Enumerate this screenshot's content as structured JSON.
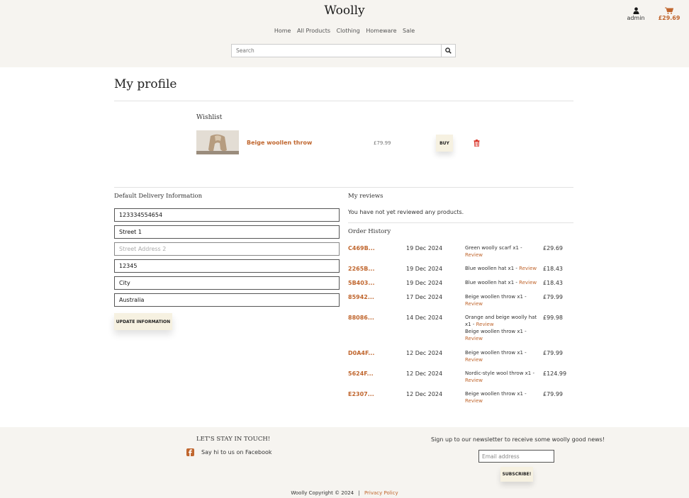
{
  "header": {
    "brand": "Woolly",
    "nav": [
      "Home",
      "All Products",
      "Clothing",
      "Homeware",
      "Sale"
    ],
    "search_placeholder": "Search",
    "account_label": "admin",
    "cart_total": "£29.69"
  },
  "profile": {
    "title": "My profile",
    "wishlist": {
      "heading": "Wishlist",
      "item": {
        "name": "Beige woollen throw",
        "price": "£79.99",
        "buy_label": "BUY"
      }
    },
    "delivery": {
      "heading": "Default Delivery Information",
      "fields": [
        {
          "value": "123334554654",
          "placeholder": ""
        },
        {
          "value": "Street 1",
          "placeholder": ""
        },
        {
          "value": "",
          "placeholder": "Street Address 2"
        },
        {
          "value": "12345",
          "placeholder": ""
        },
        {
          "value": "City",
          "placeholder": ""
        },
        {
          "value": "Australia",
          "placeholder": ""
        }
      ],
      "update_label": "UPDATE INFORMATION"
    },
    "reviews": {
      "heading": "My reviews",
      "empty_text": "You have not yet reviewed any products."
    },
    "order_history": {
      "heading": "Order History",
      "review_label": "Review",
      "orders": [
        {
          "number": "C469B...",
          "date": "19 Dec 2024",
          "items": [
            "Green woolly scarf x1 -"
          ],
          "total": "£29.69"
        },
        {
          "number": "2265B...",
          "date": "19 Dec 2024",
          "items": [
            "Blue woollen hat x1 -"
          ],
          "total": "£18.43"
        },
        {
          "number": "5B403...",
          "date": "19 Dec 2024",
          "items": [
            "Blue woollen hat x1 -"
          ],
          "total": "£18.43"
        },
        {
          "number": "85942...",
          "date": "17 Dec 2024",
          "items": [
            "Beige woollen throw x1 -"
          ],
          "total": "£79.99"
        },
        {
          "number": "88086...",
          "date": "14 Dec 2024",
          "items": [
            "Orange and beige woolly hat x1 -",
            "Beige woollen throw x1 -"
          ],
          "total": "£99.98"
        },
        {
          "number": "D0A4F...",
          "date": "12 Dec 2024",
          "items": [
            "Beige woollen throw x1 -"
          ],
          "total": "£79.99"
        },
        {
          "number": "5624F...",
          "date": "12 Dec 2024",
          "items": [
            "Nordic-style wool throw x1 -"
          ],
          "total": "£124.99"
        },
        {
          "number": "E2307...",
          "date": "12 Dec 2024",
          "items": [
            "Beige woollen throw x1 -"
          ],
          "total": "£79.99"
        }
      ]
    }
  },
  "footer": {
    "stay_heading": "LET'S STAY IN TOUCH!",
    "facebook_text": "Say hi to us on Facebook",
    "newsletter_text": "Sign up to our newsletter to receive some woolly good news!",
    "email_placeholder": "Email address",
    "subscribe_label": "SUBSCRIBE!",
    "copyright": "Woolly Copyright © 2024",
    "separator": "|",
    "privacy_label": "Privacy Policy"
  },
  "colors": {
    "accent": "#c0662e",
    "header_bg": "#f6f4f0",
    "button_bg": "#f6f1e1"
  },
  "icons": {
    "account": "user-icon",
    "cart": "cart-icon",
    "search": "search-icon",
    "delete": "trash-icon",
    "facebook": "facebook-icon"
  }
}
